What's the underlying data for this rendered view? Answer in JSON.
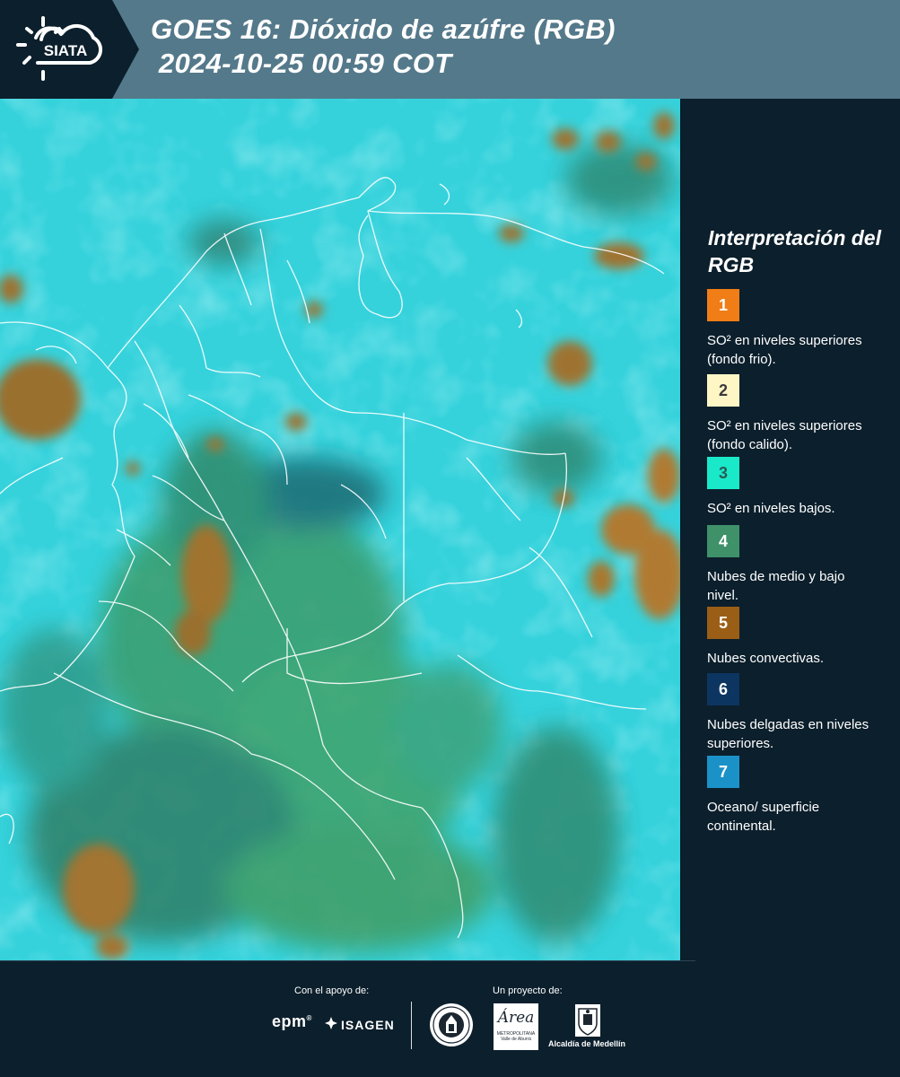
{
  "header": {
    "logo_text": "SIATA",
    "title_line1": "GOES 16: Dióxido de azúfre (RGB)",
    "title_line2": " 2024-10-25 00:59 COT",
    "bg_color": "#54798a"
  },
  "legend": {
    "title": "Interpretación del RGB",
    "items": [
      {
        "number": "1",
        "label": "SO² en niveles superiores (fondo frio).",
        "color": "#f07d16",
        "text_color": "#ffffff"
      },
      {
        "number": "2",
        "label": "SO² en niveles superiores (fondo calido).",
        "color": "#fff6c6",
        "text_color": "#3a3a3a"
      },
      {
        "number": "3",
        "label": "SO² en niveles bajos.",
        "color": "#19e9c9",
        "text_color": "#2a5a55"
      },
      {
        "number": "4",
        "label": "Nubes de medio y bajo nivel.",
        "color": "#3f916a",
        "text_color": "#ffffff"
      },
      {
        "number": "5",
        "label": "Nubes convectivas.",
        "color": "#9b5e16",
        "text_color": "#ffffff"
      },
      {
        "number": "6",
        "label": "Nubes delgadas en niveles superiores.",
        "color": "#0d3561",
        "text_color": "#ffffff"
      },
      {
        "number": "7",
        "label": "Oceano/ superficie continental.",
        "color": "#1b92c7",
        "text_color": "#ffffff"
      }
    ]
  },
  "footer": {
    "support_label": "Con el apoyo de:",
    "project_label": "Un proyecto de:",
    "epm": "epm",
    "epm_mark": "®",
    "isagen": "ISAGEN",
    "area_name": "Área",
    "area_sub1": "METROPOLITANA",
    "area_sub2": "Valle de Aburrá",
    "alcaldia": "Alcaldía de Medellín"
  },
  "icons": {
    "logo": "sun-cloud-icon",
    "isagen": "isagen-star-icon",
    "seal": "medellin-seal-icon",
    "alcaldia": "coat-of-arms-icon"
  }
}
